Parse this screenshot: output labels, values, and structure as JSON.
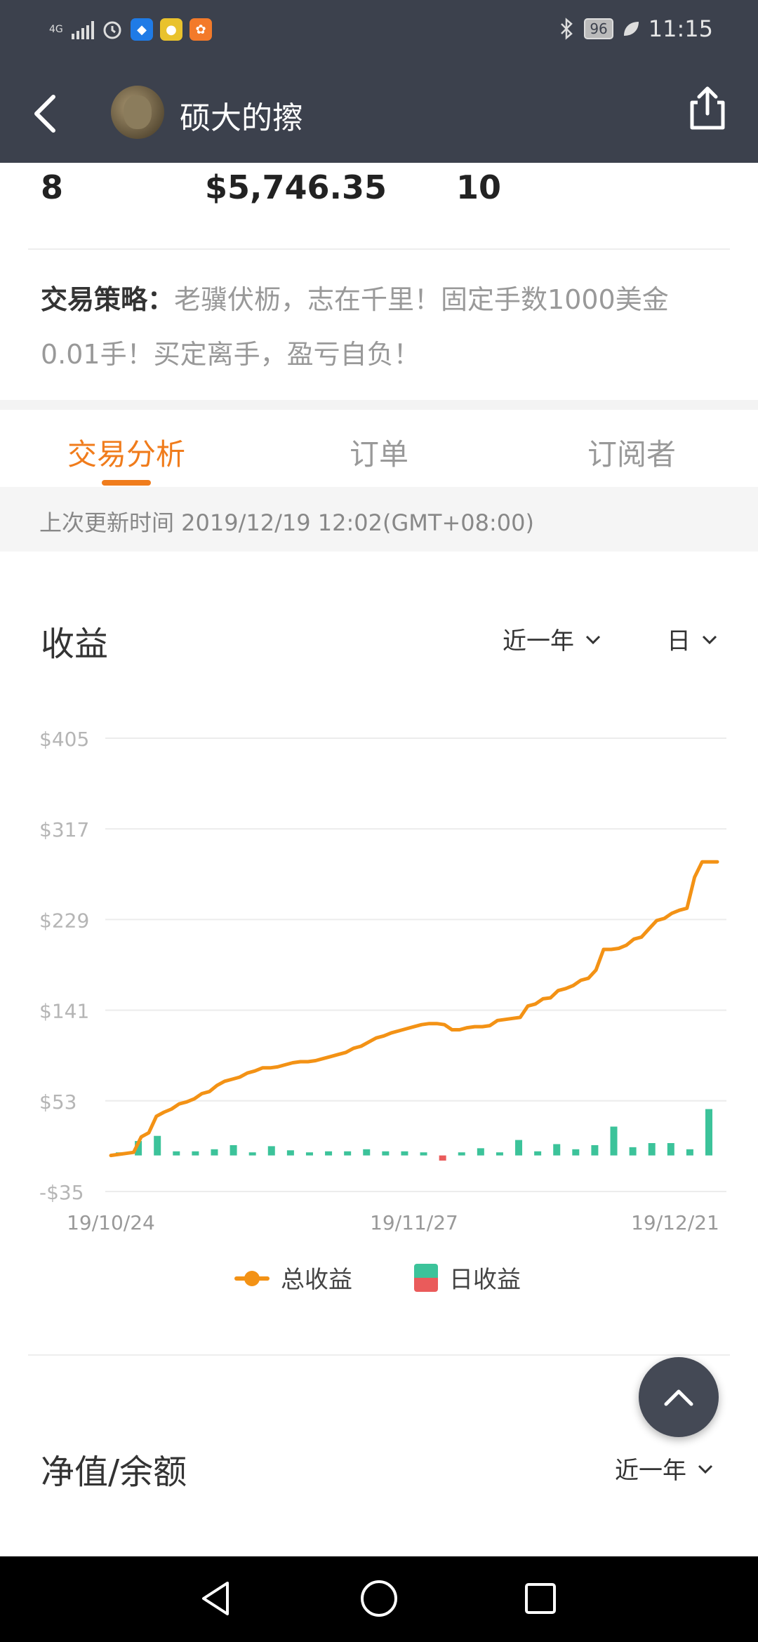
{
  "status_bar": {
    "network": "4G",
    "battery": "96",
    "time": "11:15",
    "icons": [
      "signal-icon",
      "alarm-icon",
      "shield-app-icon",
      "medal-app-icon",
      "uc-browser-icon",
      "bluetooth-icon",
      "leaf-icon"
    ]
  },
  "header": {
    "title": "硕大的擦",
    "back_icon": "chevron-left-icon",
    "share_icon": "share-icon"
  },
  "stats": {
    "values": [
      "8",
      "$5,746.35",
      "10"
    ]
  },
  "strategy": {
    "label": "交易策略：",
    "text": "老骥伏枥，志在千里！固定手数1000美金0.01手！买定离手，盈亏自负！"
  },
  "tabs": [
    {
      "label": "交易分析",
      "active": true
    },
    {
      "label": "订单",
      "active": false
    },
    {
      "label": "订阅者",
      "active": false
    }
  ],
  "update": {
    "text": "上次更新时间 2019/12/19 12:02(GMT+08:00)"
  },
  "profit_section": {
    "title": "收益",
    "period_dropdown": "近一年",
    "granularity_dropdown": "日"
  },
  "chart_data": {
    "type": "line",
    "title": "收益",
    "y_ticks": [
      "$405",
      "$317",
      "$229",
      "$141",
      "$53",
      "-$35"
    ],
    "ylim": [
      -35,
      405
    ],
    "x_ticks": [
      "19/10/24",
      "19/11/27",
      "19/12/21"
    ],
    "series": [
      {
        "name": "总收益",
        "type": "line",
        "color": "#f39215",
        "values": [
          0,
          1,
          2,
          3,
          18,
          22,
          38,
          42,
          45,
          50,
          52,
          55,
          60,
          62,
          68,
          72,
          74,
          76,
          80,
          82,
          85,
          85,
          86,
          88,
          90,
          91,
          91,
          92,
          94,
          96,
          98,
          100,
          104,
          106,
          110,
          114,
          116,
          119,
          121,
          123,
          125,
          127,
          128,
          128,
          127,
          122,
          122,
          124,
          125,
          125,
          126,
          131,
          132,
          133,
          134,
          145,
          147,
          152,
          153,
          160,
          162,
          165,
          170,
          172,
          180,
          200,
          200,
          201,
          204,
          210,
          212,
          220,
          228,
          230,
          235,
          238,
          240,
          270,
          285,
          285,
          285
        ]
      },
      {
        "name": "日收益",
        "type": "bar",
        "color_positive": "#3cc39a",
        "color_negative": "#ea5b5b",
        "values": [
          3,
          14,
          19,
          4,
          4,
          6,
          10,
          3,
          9,
          5,
          3,
          4,
          4,
          6,
          4,
          4,
          3,
          -5,
          3,
          7,
          3,
          15,
          4,
          11,
          6,
          10,
          28,
          8,
          12,
          12,
          6,
          45
        ]
      }
    ],
    "legend": [
      "总收益",
      "日收益"
    ],
    "legend_position": "bottom",
    "grid": true
  },
  "fab": {
    "icon": "chevron-up-icon"
  },
  "equity_section": {
    "title": "净值/余额",
    "period_dropdown": "近一年"
  },
  "nav_bar": {
    "icons": [
      "nav-back-icon",
      "nav-home-icon",
      "nav-recents-icon"
    ]
  },
  "colors": {
    "header_bg": "#3c414d",
    "accent": "#f07c1c",
    "line": "#f39215",
    "bar_positive": "#3cc39a",
    "bar_negative": "#ea5b5b"
  }
}
